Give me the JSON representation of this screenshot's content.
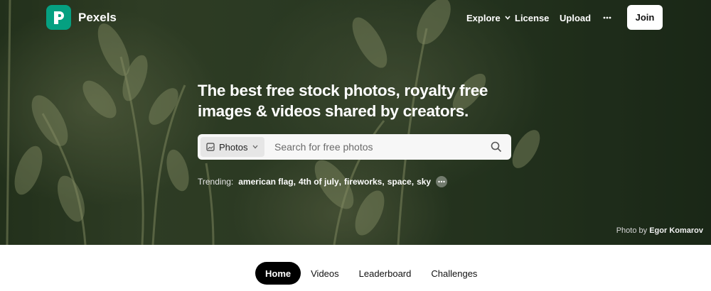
{
  "brand": {
    "name": "Pexels",
    "logo_icon": "pexels-logo-icon",
    "logo_color": "#05a081"
  },
  "nav": {
    "explore": "Explore",
    "license": "License",
    "upload": "Upload",
    "more_icon": "more-horizontal-icon",
    "join": "Join"
  },
  "hero": {
    "headline_line1": "The best free stock photos, royalty free",
    "headline_line2": "images & videos shared by creators.",
    "search": {
      "type_selected": "Photos",
      "type_icon": "image-icon",
      "placeholder": "Search for free photos",
      "value": "",
      "search_icon": "search-icon"
    },
    "trending": {
      "label": "Trending:",
      "items": [
        "american flag",
        "4th of july",
        "fireworks",
        "space",
        "sky"
      ]
    },
    "credit": {
      "prefix": "Photo by",
      "author": "Egor Komarov"
    }
  },
  "tabs": [
    {
      "label": "Home",
      "active": true
    },
    {
      "label": "Videos",
      "active": false
    },
    {
      "label": "Leaderboard",
      "active": false
    },
    {
      "label": "Challenges",
      "active": false
    }
  ]
}
